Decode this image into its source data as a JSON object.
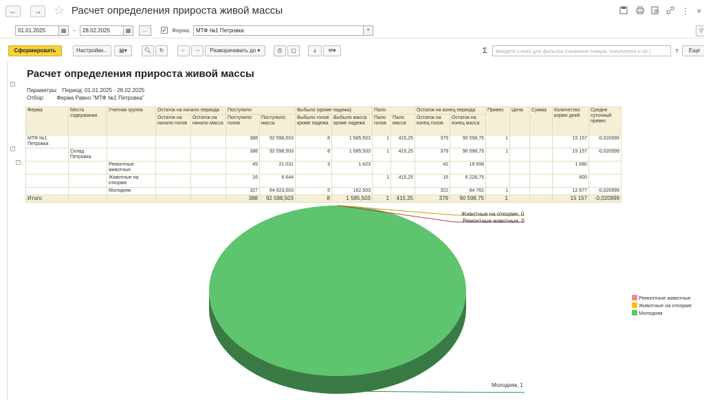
{
  "window": {
    "title": "Расчет определения прироста живой массы",
    "back_icon": "←",
    "forward_icon": "→",
    "favorite_icon": "☆",
    "icons": [
      "save-icon",
      "print-icon",
      "preview-icon",
      "link-icon",
      "more-icon",
      "close-icon"
    ]
  },
  "params": {
    "date_from": "01.01.2025",
    "date_to": "28.02.2025",
    "dash": "–",
    "dots": "...",
    "farm_label": "Ферма:",
    "farm_value": "МТФ №1 Петровка",
    "farm_checked": true
  },
  "toolbar": {
    "generate": "Сформировать",
    "settings": "Настройки...",
    "expand": "Разворачивать до",
    "filter_placeholder": "Введите слово для фильтра (название товара, покупателя и пр.)",
    "help": "?",
    "more": "Еще",
    "sigma": "Σ"
  },
  "report": {
    "title": "Расчет определения прироста живой массы",
    "params_label": "Параметры:",
    "params_value": "Период: 01.01.2025 - 28.02.2025",
    "filter_label": "Отбор:",
    "filter_value": "Ферма Равно \"МТФ №1 Петровка\""
  },
  "table": {
    "headers": {
      "farm": "Ферма",
      "place": "Место содержания",
      "group": "Учетная группа",
      "start": "Остаток на начало периода",
      "start_heads": "Остаток на начало голов",
      "start_mass": "Остаток на начало масса",
      "in": "Поступило",
      "in_heads": "Поступило голов",
      "in_mass": "Поступило масса",
      "out": "Выбыло (кроме падежа)",
      "out_heads": "Выбыло голов кроме падежа",
      "out_mass": "Выбыло масса кроме падежа",
      "dead": "Пало",
      "dead_heads": "Пало голов",
      "dead_mass": "Пало масса",
      "end": "Остаток на конец периода",
      "end_heads": "Остаток на конец голов",
      "end_mass": "Остаток на конец масса",
      "gain": "Привес",
      "price": "Цена",
      "sum": "Сумма",
      "feed_days": "Количество кормо дней",
      "avg_gain": "Средне суточный привес"
    },
    "rows": [
      [
        "МТФ №1 Петровка",
        "",
        "",
        "",
        "",
        "388",
        "92 598,503",
        "8",
        "1 585,503",
        "1",
        "415,25",
        "379",
        "90 598,75",
        "1",
        "",
        "",
        "15 157",
        "-0,020999"
      ],
      [
        "",
        "Склад Петровка",
        "",
        "",
        "",
        "388",
        "92 598,503",
        "8",
        "1 585,503",
        "1",
        "415,25",
        "379",
        "90 598,75",
        "1",
        "",
        "",
        "15 157",
        "-0,020999"
      ],
      [
        "",
        "",
        "Ремонтные животные",
        "",
        "",
        "45",
        "21 031",
        "3",
        "1 423",
        "",
        "",
        "42",
        "19 608",
        "",
        "",
        "",
        "1 680",
        ""
      ],
      [
        "",
        "",
        "Животные на откорме",
        "",
        "",
        "16",
        "6 644",
        "",
        "",
        "1",
        "415,25",
        "15",
        "6 228,75",
        "",
        "",
        "",
        "600",
        ""
      ],
      [
        "",
        "",
        "Молодняк",
        "",
        "",
        "327",
        "64 923,503",
        "5",
        "162,503",
        "",
        "",
        "322",
        "64 762",
        "1",
        "",
        "",
        "12 877",
        "-0,020999"
      ]
    ],
    "total": [
      "Итого",
      "",
      "",
      "",
      "",
      "388",
      "92 598,503",
      "8",
      "1 585,503",
      "1",
      "415,25",
      "379",
      "90 598,75",
      "1",
      "",
      "",
      "15 157",
      "-0,020999"
    ]
  },
  "chart_data": {
    "type": "pie",
    "categories": [
      "Ремонтные животные",
      "Животные на откорме",
      "Молодняк"
    ],
    "values": [
      0,
      0,
      1
    ],
    "colors": [
      "#f08a8a",
      "#f5c400",
      "#5ec46e"
    ],
    "data_labels": [
      "Ремонтные животные, 0",
      "Животные на откорме, 0",
      "Молодняк, 1"
    ],
    "legend": "right"
  }
}
